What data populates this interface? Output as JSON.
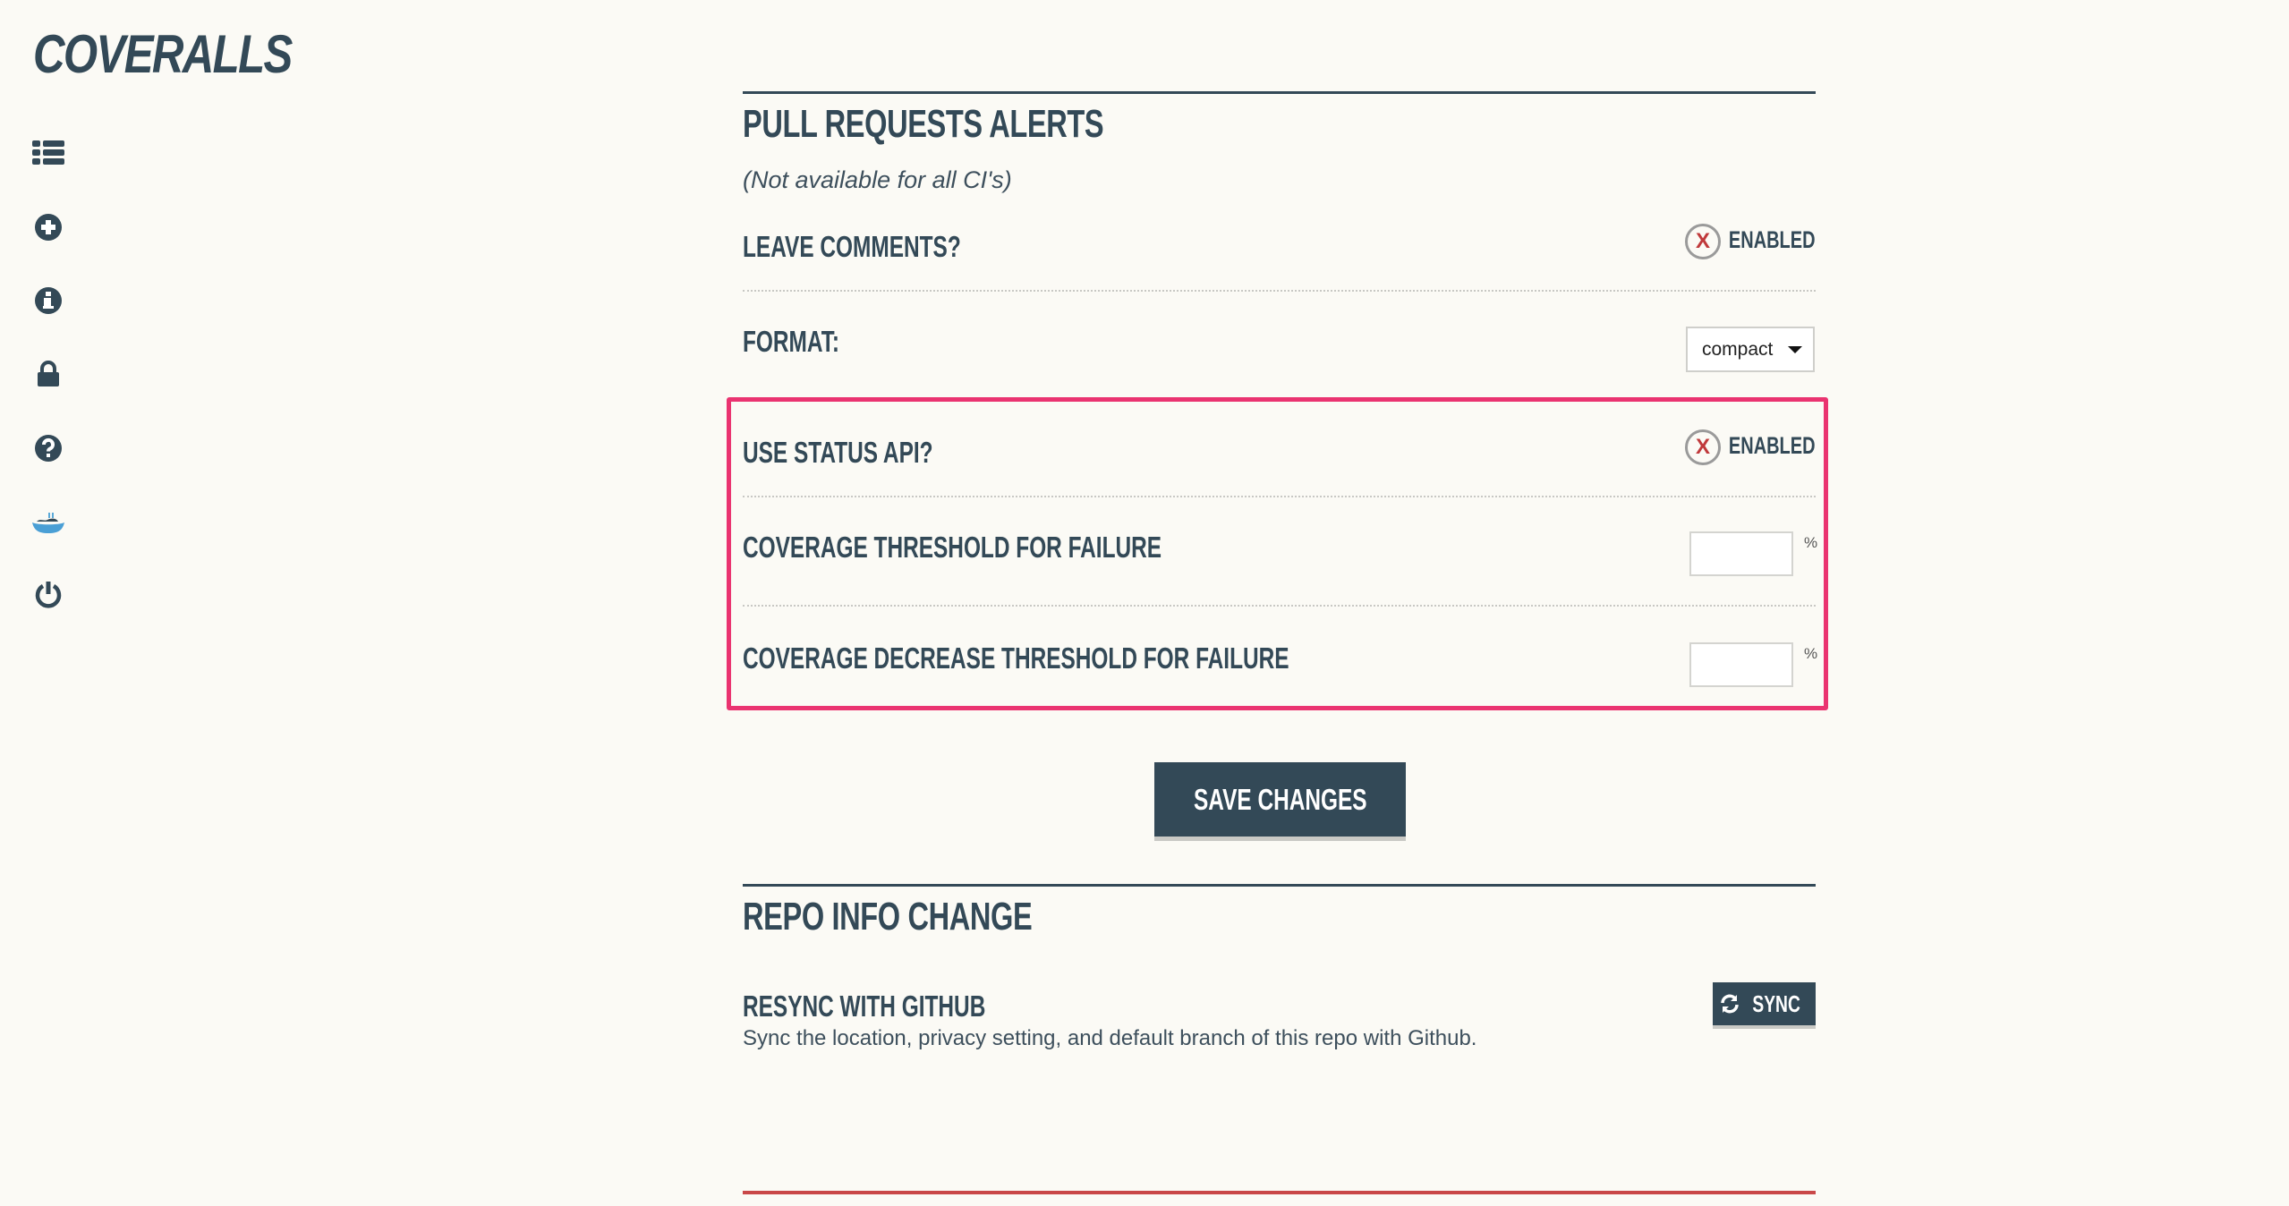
{
  "logo": "COVERALLS",
  "sidebar": {
    "icons": [
      "list-icon",
      "add-circle-icon",
      "info-icon",
      "lock-icon",
      "help-icon",
      "whale-icon",
      "power-icon"
    ]
  },
  "pull_requests": {
    "title": "PULL REQUESTS ALERTS",
    "subtitle": "(Not available for all CI's)",
    "leave_comments": {
      "label": "LEAVE COMMENTS?",
      "toggle_mark": "X",
      "status": "ENABLED"
    },
    "format": {
      "label": "FORMAT:",
      "selected": "compact"
    },
    "status_api": {
      "label": "USE STATUS API?",
      "toggle_mark": "X",
      "status": "ENABLED"
    },
    "threshold": {
      "label": "COVERAGE THRESHOLD FOR FAILURE",
      "value": "",
      "unit": "%"
    },
    "decrease_threshold": {
      "label": "COVERAGE DECREASE THRESHOLD FOR FAILURE",
      "value": "",
      "unit": "%"
    },
    "save_label": "SAVE CHANGES"
  },
  "repo_info": {
    "title": "REPO INFO CHANGE",
    "resync_label": "RESYNC WITH GITHUB",
    "resync_desc": "Sync the location, privacy setting, and default branch of this repo with Github.",
    "sync_label": "SYNC"
  },
  "colors": {
    "text": "#334957",
    "highlight": "#ea3370",
    "disabled_x": "#c0393b",
    "bottom_rule": "#c94848"
  }
}
